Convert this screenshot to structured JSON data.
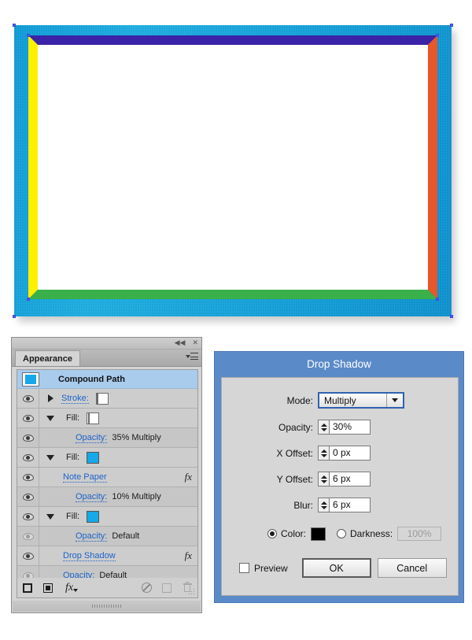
{
  "artwork": {
    "name": "compound-path-frame",
    "outer_frame_color": "#12a3dd",
    "inner_band_top_color": "#3b23a8",
    "inner_band_left_color": "#ffef00",
    "inner_band_right_color": "#e8562a",
    "inner_band_bottom_color": "#3ab04a",
    "canvas_color": "#ffffff",
    "anchor_color": "#4f5fe8"
  },
  "panel": {
    "tab_label": "Appearance",
    "collapse_icon": "◀◀",
    "close_icon": "✕",
    "menu_icon": "panel-menu-icon",
    "rows": [
      {
        "type": "header",
        "label": "Compound Path",
        "thumb": "cyan-square-thumbnail"
      },
      {
        "type": "stroke",
        "eye": "visible",
        "disclosure": "collapsed",
        "label": "Stroke:",
        "swatch": "none-swatch",
        "fx": ""
      },
      {
        "type": "fill",
        "eye": "visible",
        "disclosure": "expanded",
        "label": "Fill:",
        "swatch": "gradient-swatch",
        "fx": ""
      },
      {
        "type": "opacity",
        "eye": "visible",
        "label": "Opacity:",
        "value": "35% Multiply",
        "fx": ""
      },
      {
        "type": "fill",
        "eye": "visible",
        "disclosure": "expanded",
        "label": "Fill:",
        "swatch": "cyan-swatch",
        "fx": ""
      },
      {
        "type": "effect",
        "eye": "visible",
        "label": "Note Paper",
        "fx": "fx"
      },
      {
        "type": "opacity",
        "eye": "visible",
        "label": "Opacity:",
        "value": "10% Multiply",
        "fx": ""
      },
      {
        "type": "fill",
        "eye": "visible",
        "disclosure": "expanded",
        "label": "Fill:",
        "swatch": "cyan-swatch",
        "fx": ""
      },
      {
        "type": "opacity",
        "eye": "dim",
        "label": "Opacity:",
        "value": "Default",
        "fx": ""
      },
      {
        "type": "effect",
        "eye": "visible",
        "label": "Drop Shadow",
        "fx": "fx"
      },
      {
        "type": "opacity",
        "eye": "dim",
        "label": "Opacity:",
        "value": "Default",
        "fx": ""
      }
    ],
    "footer": {
      "add_new_stroke": "add-new-stroke-icon",
      "add_new_fill": "add-new-fill-icon",
      "add_new_effect": "add-new-effect-fx-icon",
      "clear_appearance": "clear-appearance-icon",
      "duplicate_item": "duplicate-selected-item-icon",
      "delete_item": "delete-selected-item-icon"
    }
  },
  "dialog": {
    "title": "Drop Shadow",
    "fields": {
      "mode_label": "Mode:",
      "mode_value": "Multiply",
      "opacity_label": "Opacity:",
      "opacity_value": "30%",
      "x_offset_label": "X Offset:",
      "x_offset_value": "0 px",
      "y_offset_label": "Y Offset:",
      "y_offset_value": "6 px",
      "blur_label": "Blur:",
      "blur_value": "6 px",
      "color_radio_label": "Color:",
      "color_value": "#000000",
      "darkness_radio_label": "Darkness:",
      "darkness_value": "100%",
      "color_selected": true,
      "darkness_selected": false
    },
    "preview_label": "Preview",
    "preview_checked": false,
    "ok_label": "OK",
    "cancel_label": "Cancel",
    "title_bar_color": "#5b8ac9",
    "body_color": "#d6d6d6"
  }
}
